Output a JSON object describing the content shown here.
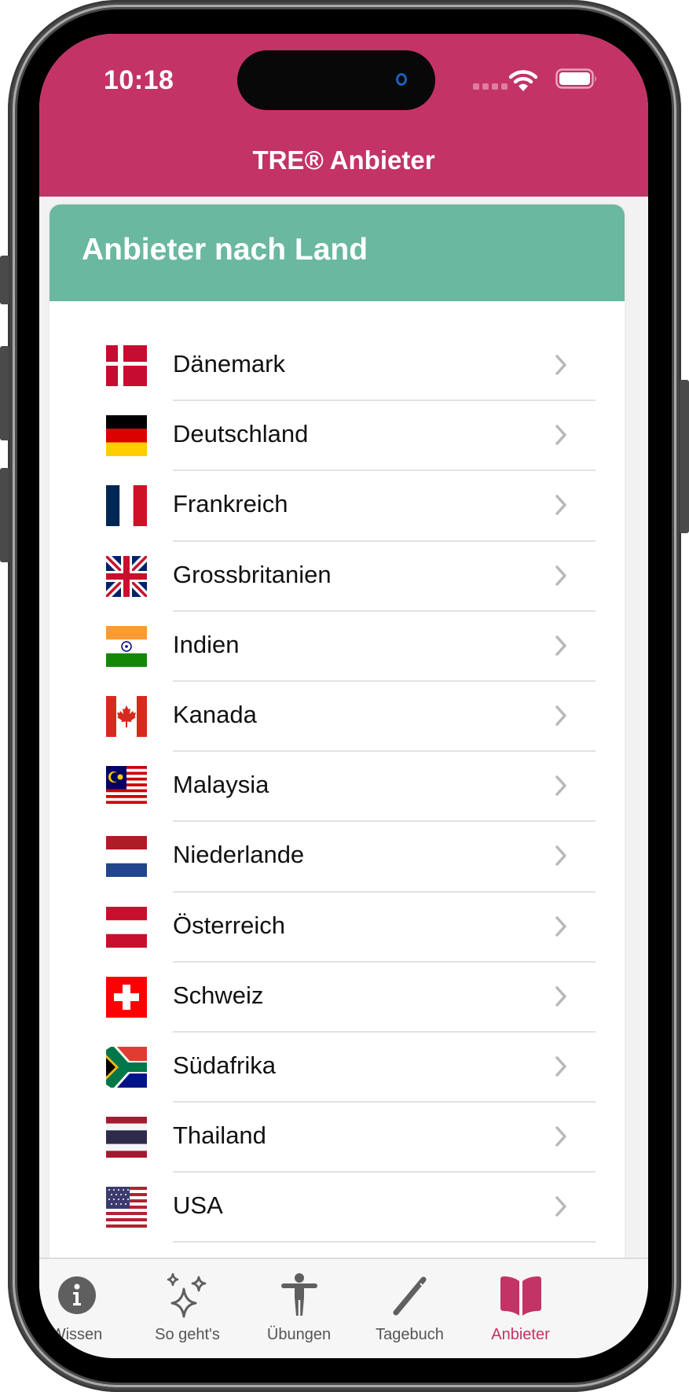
{
  "status_bar": {
    "time": "10:18",
    "icons": [
      "cellular-signal-icon",
      "wifi-icon",
      "battery-icon"
    ]
  },
  "nav": {
    "title": "TRE® Anbieter"
  },
  "section": {
    "title": "Anbieter nach Land"
  },
  "countries": [
    {
      "label": "Dänemark",
      "flag": "denmark-flag-icon"
    },
    {
      "label": "Deutschland",
      "flag": "germany-flag-icon"
    },
    {
      "label": "Frankreich",
      "flag": "france-flag-icon"
    },
    {
      "label": "Grossbritanien",
      "flag": "uk-flag-icon"
    },
    {
      "label": "Indien",
      "flag": "india-flag-icon"
    },
    {
      "label": "Kanada",
      "flag": "canada-flag-icon"
    },
    {
      "label": "Malaysia",
      "flag": "malaysia-flag-icon"
    },
    {
      "label": "Niederlande",
      "flag": "netherlands-flag-icon"
    },
    {
      "label": "Österreich",
      "flag": "austria-flag-icon"
    },
    {
      "label": "Schweiz",
      "flag": "switzerland-flag-icon"
    },
    {
      "label": "Südafrika",
      "flag": "south-africa-flag-icon"
    },
    {
      "label": "Thailand",
      "flag": "thailand-flag-icon"
    },
    {
      "label": "USA",
      "flag": "usa-flag-icon"
    }
  ],
  "tabs": [
    {
      "label": "Wissen",
      "icon": "info-circle-icon",
      "active": false
    },
    {
      "label": "So geht's",
      "icon": "sparkles-icon",
      "active": false
    },
    {
      "label": "Übungen",
      "icon": "figure-icon",
      "active": false
    },
    {
      "label": "Tagebuch",
      "icon": "pencil-icon",
      "active": false
    },
    {
      "label": "Anbieter",
      "icon": "book-icon",
      "active": true
    }
  ],
  "colors": {
    "header": "#c33366",
    "section_header": "#6ab89f",
    "active_tab": "#c33366",
    "inactive_tab": "#555555"
  }
}
